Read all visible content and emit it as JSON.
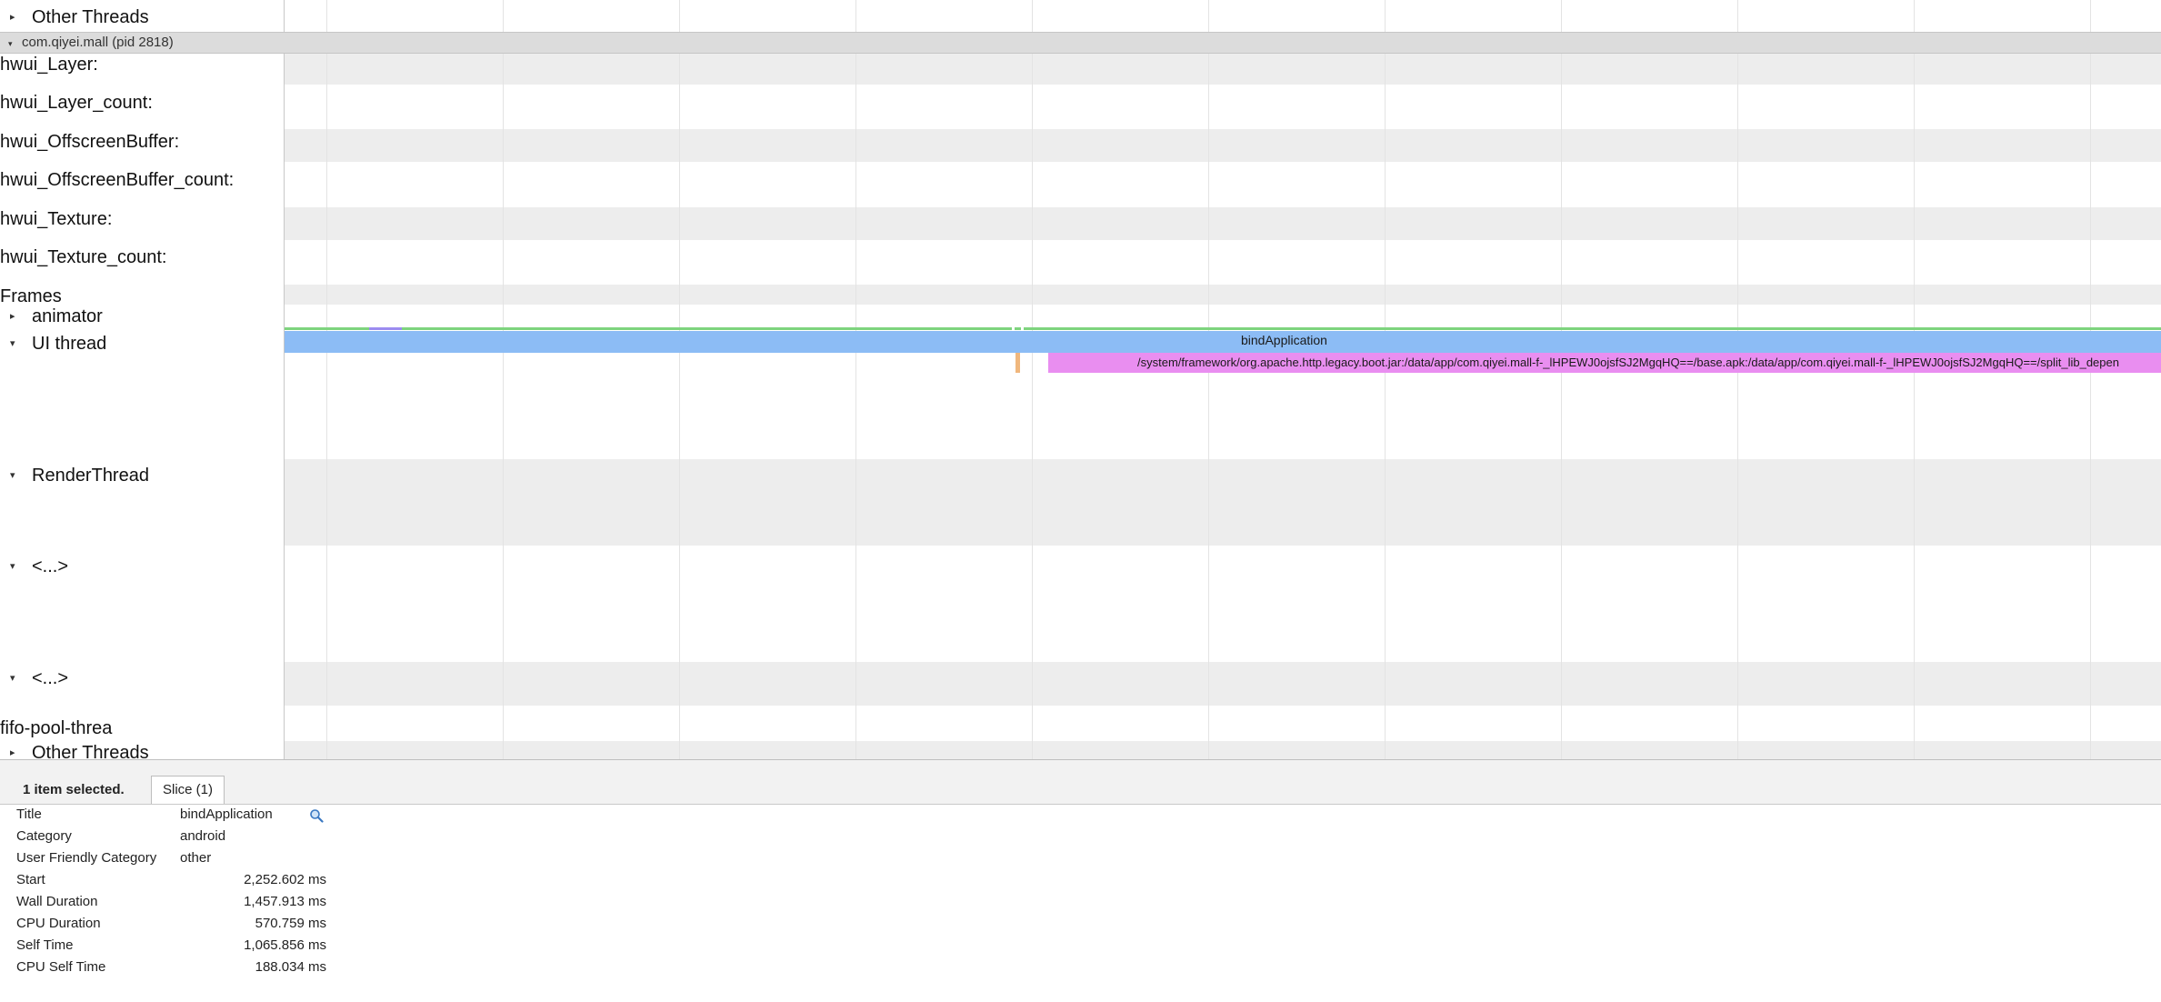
{
  "colors": {
    "bindApplication_slice": "#8cbcf5",
    "child_slice": "#e98ef0",
    "thin_marker": "#f0b77d",
    "track_stripe": "#ededed",
    "process_header": "#dcdcdc",
    "frames_strip_green": "#7ed47e",
    "frames_strip_purple": "#9c8cf0"
  },
  "tracks": {
    "other_threads_top": "Other Threads",
    "process_header": "com.qiyei.mall (pid 2818)",
    "counters": [
      "hwui_Layer:",
      "hwui_Layer_count:",
      "hwui_OffscreenBuffer:",
      "hwui_OffscreenBuffer_count:",
      "hwui_Texture:",
      "hwui_Texture_count:"
    ],
    "frames": "Frames",
    "animator": "animator",
    "ui_thread": "UI thread",
    "render_thread": "RenderThread",
    "elided_1": "<...>",
    "elided_2": "<...>",
    "fifo_pool": "fifo-pool-threa",
    "other_threads_bottom": "Other Threads"
  },
  "slices": {
    "bind_application": "bindApplication",
    "child_path": "/system/framework/org.apache.http.legacy.boot.jar:/data/app/com.qiyei.mall-f-_lHPEWJ0ojsfSJ2MgqHQ==/base.apk:/data/app/com.qiyei.mall-f-_lHPEWJ0ojsfSJ2MgqHQ==/split_lib_depen"
  },
  "icons": {
    "collapsed": "expand-right-triangle-icon",
    "expanded": "collapse-down-triangle-icon",
    "search": "magnifier-search-icon"
  },
  "selection": {
    "summary": "1 item selected.",
    "tab": "Slice (1)"
  },
  "details": {
    "title_label": "Title",
    "title_value": "bindApplication",
    "category_label": "Category",
    "category_value": "android",
    "ufc_label": "User Friendly Category",
    "ufc_value": "other",
    "start_label": "Start",
    "start_value": "2,252.602 ms",
    "wall_label": "Wall Duration",
    "wall_value": "1,457.913 ms",
    "cpu_label": "CPU Duration",
    "cpu_value": "570.759 ms",
    "self_label": "Self Time",
    "self_value": "1,065.856 ms",
    "cpu_self_label": "CPU Self Time",
    "cpu_self_value": "188.034 ms"
  }
}
